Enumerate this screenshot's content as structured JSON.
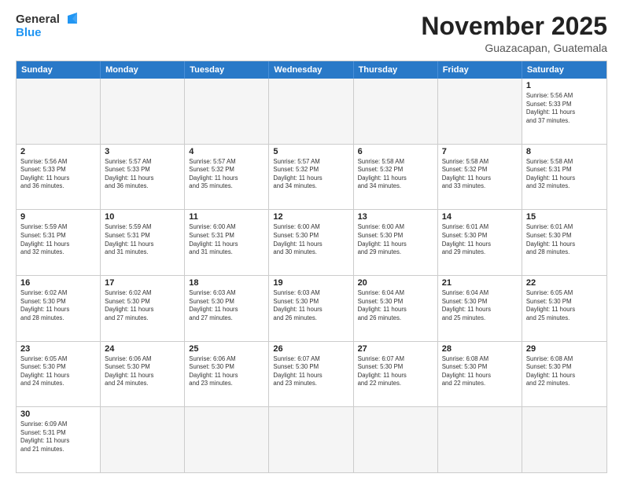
{
  "logo": {
    "text_general": "General",
    "text_blue": "Blue"
  },
  "header": {
    "month_title": "November 2025",
    "subtitle": "Guazacapan, Guatemala"
  },
  "weekdays": [
    "Sunday",
    "Monday",
    "Tuesday",
    "Wednesday",
    "Thursday",
    "Friday",
    "Saturday"
  ],
  "weeks": [
    [
      {
        "day": "",
        "info": ""
      },
      {
        "day": "",
        "info": ""
      },
      {
        "day": "",
        "info": ""
      },
      {
        "day": "",
        "info": ""
      },
      {
        "day": "",
        "info": ""
      },
      {
        "day": "",
        "info": ""
      },
      {
        "day": "1",
        "info": "Sunrise: 5:56 AM\nSunset: 5:33 PM\nDaylight: 11 hours\nand 37 minutes."
      }
    ],
    [
      {
        "day": "2",
        "info": "Sunrise: 5:56 AM\nSunset: 5:33 PM\nDaylight: 11 hours\nand 36 minutes."
      },
      {
        "day": "3",
        "info": "Sunrise: 5:57 AM\nSunset: 5:33 PM\nDaylight: 11 hours\nand 36 minutes."
      },
      {
        "day": "4",
        "info": "Sunrise: 5:57 AM\nSunset: 5:32 PM\nDaylight: 11 hours\nand 35 minutes."
      },
      {
        "day": "5",
        "info": "Sunrise: 5:57 AM\nSunset: 5:32 PM\nDaylight: 11 hours\nand 34 minutes."
      },
      {
        "day": "6",
        "info": "Sunrise: 5:58 AM\nSunset: 5:32 PM\nDaylight: 11 hours\nand 34 minutes."
      },
      {
        "day": "7",
        "info": "Sunrise: 5:58 AM\nSunset: 5:32 PM\nDaylight: 11 hours\nand 33 minutes."
      },
      {
        "day": "8",
        "info": "Sunrise: 5:58 AM\nSunset: 5:31 PM\nDaylight: 11 hours\nand 32 minutes."
      }
    ],
    [
      {
        "day": "9",
        "info": "Sunrise: 5:59 AM\nSunset: 5:31 PM\nDaylight: 11 hours\nand 32 minutes."
      },
      {
        "day": "10",
        "info": "Sunrise: 5:59 AM\nSunset: 5:31 PM\nDaylight: 11 hours\nand 31 minutes."
      },
      {
        "day": "11",
        "info": "Sunrise: 6:00 AM\nSunset: 5:31 PM\nDaylight: 11 hours\nand 31 minutes."
      },
      {
        "day": "12",
        "info": "Sunrise: 6:00 AM\nSunset: 5:30 PM\nDaylight: 11 hours\nand 30 minutes."
      },
      {
        "day": "13",
        "info": "Sunrise: 6:00 AM\nSunset: 5:30 PM\nDaylight: 11 hours\nand 29 minutes."
      },
      {
        "day": "14",
        "info": "Sunrise: 6:01 AM\nSunset: 5:30 PM\nDaylight: 11 hours\nand 29 minutes."
      },
      {
        "day": "15",
        "info": "Sunrise: 6:01 AM\nSunset: 5:30 PM\nDaylight: 11 hours\nand 28 minutes."
      }
    ],
    [
      {
        "day": "16",
        "info": "Sunrise: 6:02 AM\nSunset: 5:30 PM\nDaylight: 11 hours\nand 28 minutes."
      },
      {
        "day": "17",
        "info": "Sunrise: 6:02 AM\nSunset: 5:30 PM\nDaylight: 11 hours\nand 27 minutes."
      },
      {
        "day": "18",
        "info": "Sunrise: 6:03 AM\nSunset: 5:30 PM\nDaylight: 11 hours\nand 27 minutes."
      },
      {
        "day": "19",
        "info": "Sunrise: 6:03 AM\nSunset: 5:30 PM\nDaylight: 11 hours\nand 26 minutes."
      },
      {
        "day": "20",
        "info": "Sunrise: 6:04 AM\nSunset: 5:30 PM\nDaylight: 11 hours\nand 26 minutes."
      },
      {
        "day": "21",
        "info": "Sunrise: 6:04 AM\nSunset: 5:30 PM\nDaylight: 11 hours\nand 25 minutes."
      },
      {
        "day": "22",
        "info": "Sunrise: 6:05 AM\nSunset: 5:30 PM\nDaylight: 11 hours\nand 25 minutes."
      }
    ],
    [
      {
        "day": "23",
        "info": "Sunrise: 6:05 AM\nSunset: 5:30 PM\nDaylight: 11 hours\nand 24 minutes."
      },
      {
        "day": "24",
        "info": "Sunrise: 6:06 AM\nSunset: 5:30 PM\nDaylight: 11 hours\nand 24 minutes."
      },
      {
        "day": "25",
        "info": "Sunrise: 6:06 AM\nSunset: 5:30 PM\nDaylight: 11 hours\nand 23 minutes."
      },
      {
        "day": "26",
        "info": "Sunrise: 6:07 AM\nSunset: 5:30 PM\nDaylight: 11 hours\nand 23 minutes."
      },
      {
        "day": "27",
        "info": "Sunrise: 6:07 AM\nSunset: 5:30 PM\nDaylight: 11 hours\nand 22 minutes."
      },
      {
        "day": "28",
        "info": "Sunrise: 6:08 AM\nSunset: 5:30 PM\nDaylight: 11 hours\nand 22 minutes."
      },
      {
        "day": "29",
        "info": "Sunrise: 6:08 AM\nSunset: 5:30 PM\nDaylight: 11 hours\nand 22 minutes."
      }
    ],
    [
      {
        "day": "30",
        "info": "Sunrise: 6:09 AM\nSunset: 5:31 PM\nDaylight: 11 hours\nand 21 minutes."
      },
      {
        "day": "",
        "info": ""
      },
      {
        "day": "",
        "info": ""
      },
      {
        "day": "",
        "info": ""
      },
      {
        "day": "",
        "info": ""
      },
      {
        "day": "",
        "info": ""
      },
      {
        "day": "",
        "info": ""
      }
    ]
  ]
}
